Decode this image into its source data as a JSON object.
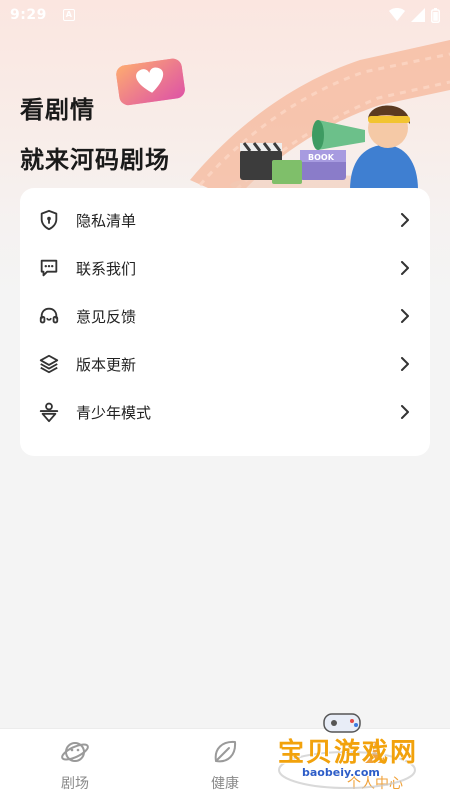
{
  "status_bar": {
    "time": "9:29",
    "app_glyph": "A",
    "icons": [
      "wifi-icon",
      "signal-icon",
      "battery-icon"
    ]
  },
  "hero": {
    "line1": "看剧情",
    "line2": "就来河码剧场",
    "book_label": "BOOK"
  },
  "menu": {
    "items": [
      {
        "label": "隐私清单",
        "icon": "shield-keyhole-icon"
      },
      {
        "label": "联系我们",
        "icon": "chat-bubble-icon"
      },
      {
        "label": "意见反馈",
        "icon": "headset-icon"
      },
      {
        "label": "版本更新",
        "icon": "layers-icon"
      },
      {
        "label": "青少年模式",
        "icon": "youth-mode-icon"
      }
    ]
  },
  "tabbar": {
    "tabs": [
      {
        "label": "剧场",
        "icon": "planet-icon",
        "active": false
      },
      {
        "label": "健康",
        "icon": "leaf-icon",
        "active": false
      },
      {
        "label": "个人中心",
        "icon": "person-icon",
        "active": true
      }
    ]
  },
  "watermark": {
    "text": "宝贝游戏网",
    "url": "baobeiy.com"
  },
  "colors": {
    "accent": "#f0a23a",
    "icon_dark": "#333333",
    "tab_inactive": "#8a8a8a"
  }
}
